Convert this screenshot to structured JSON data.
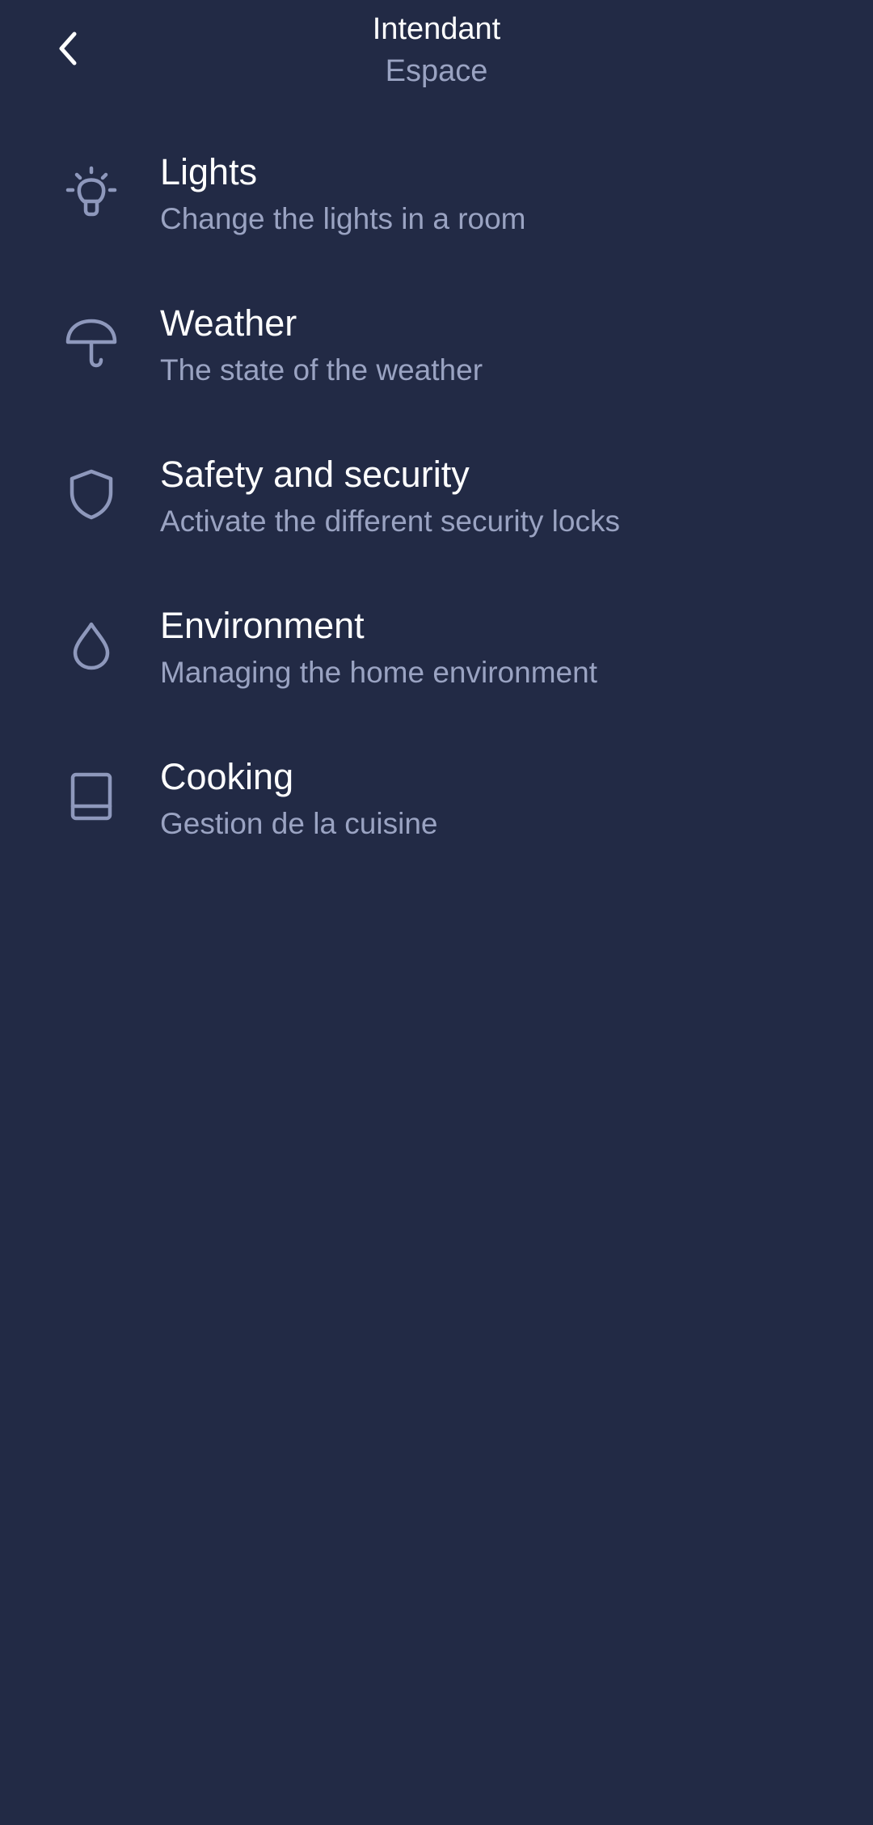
{
  "colors": {
    "background": "#222a45",
    "title_text": "#ffffff",
    "secondary_text": "#9aa3c2",
    "icon_stroke": "#8e98bc"
  },
  "header": {
    "back_icon": "chevron-left-icon",
    "title": "Intendant",
    "subtitle": "Espace"
  },
  "menu": {
    "items": [
      {
        "icon": "lightbulb-icon",
        "title": "Lights",
        "description": "Change the lights in a room"
      },
      {
        "icon": "umbrella-icon",
        "title": "Weather",
        "description": "The state of the weather"
      },
      {
        "icon": "shield-icon",
        "title": "Safety and security",
        "description": "Activate the different security locks"
      },
      {
        "icon": "droplet-icon",
        "title": "Environment",
        "description": "Managing the home environment"
      },
      {
        "icon": "book-icon",
        "title": "Cooking",
        "description": "Gestion de la cuisine"
      }
    ]
  }
}
